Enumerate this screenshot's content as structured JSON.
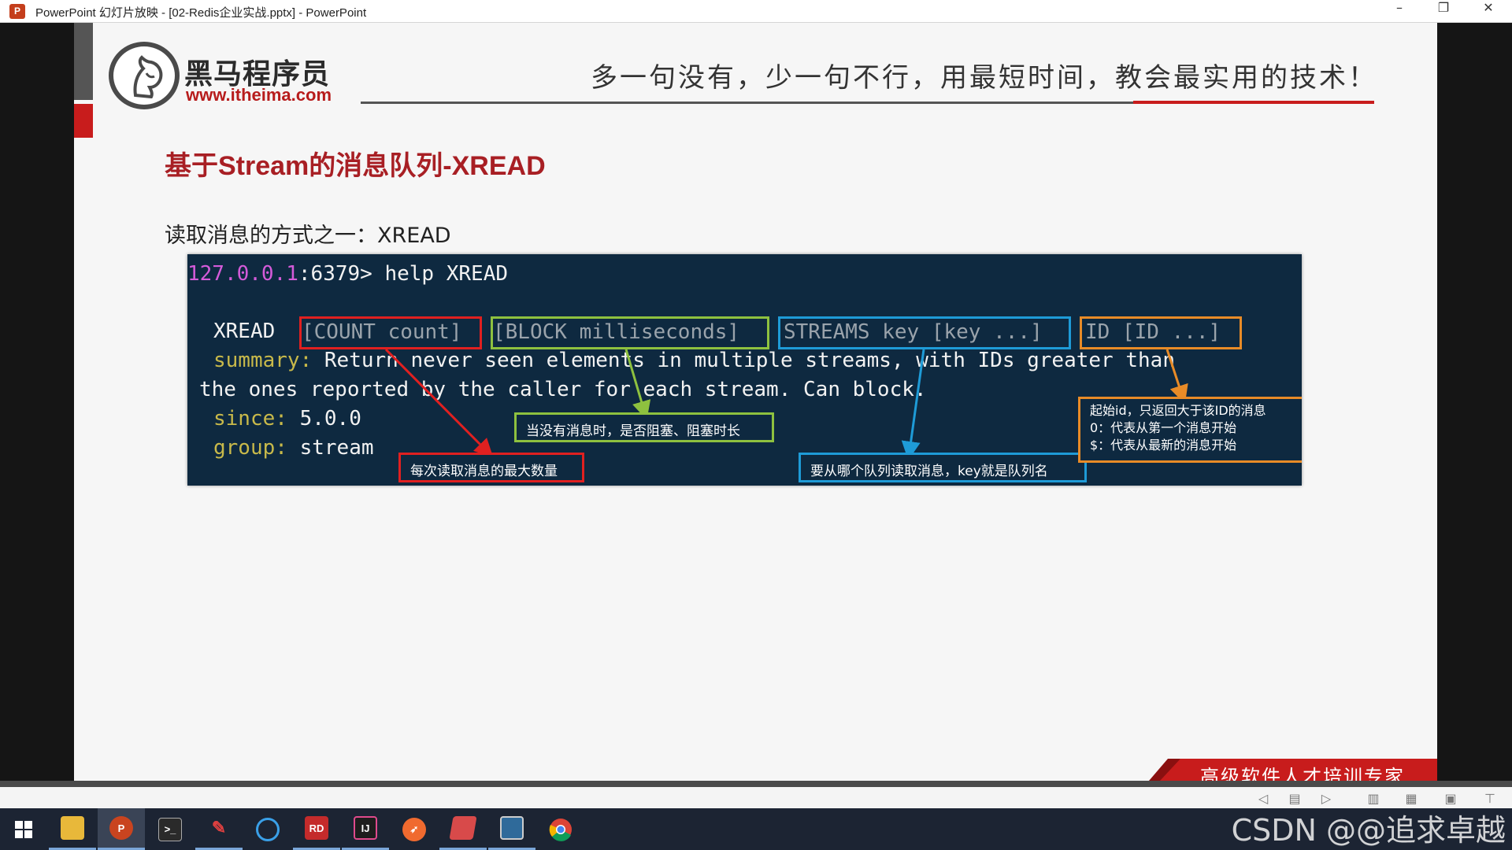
{
  "window": {
    "title": "PowerPoint 幻灯片放映 - [02-Redis企业实战.pptx] - PowerPoint",
    "app_icon": "P",
    "minimize": "–",
    "restore": "❐",
    "close": "✕"
  },
  "slide": {
    "logo_cn": "黑马程序员",
    "logo_url": "www.itheima.com",
    "slogan": "多一句没有，少一句不行，用最短时间，教会最实用的技术！",
    "title": "基于Stream的消息队列-XREAD",
    "subtitle": "读取消息的方式之一：XREAD",
    "terminal": {
      "prompt_ip": "127.0.0.1",
      "prompt_rest": ":6379> help XREAD",
      "cmd": "XREAD",
      "args": [
        "[COUNT count]",
        "[BLOCK milliseconds]",
        "STREAMS key [key ...]",
        "ID [ID ...]"
      ],
      "summary_label": "summary:",
      "summary_text_1": " Return never seen elements in multiple streams, with IDs greater than",
      "summary_text_2": "the ones reported by the caller for each stream. Can block.",
      "since_label": "since:",
      "since_value": " 5.0.0",
      "group_label": "group:",
      "group_value": " stream"
    },
    "notes": {
      "count": "每次读取消息的最大数量",
      "block": "当没有消息时，是否阻塞、阻塞时长",
      "key": "要从哪个队列读取消息，key就是队列名",
      "id_line1": "起始id，只返回大于该ID的消息",
      "id_line2": "0：代表从第一个消息开始",
      "id_line3": "$：代表从最新的消息开始"
    },
    "ribbon": "高级软件人才培训专家"
  },
  "colors": {
    "title_red": "#a81f24",
    "terminal_bg": "#0e2940",
    "count_box": "#e02020",
    "block_box": "#8ec13f",
    "streams_box": "#1e9bd7",
    "id_box": "#e88b27"
  },
  "taskbar": {
    "items": [
      "windows-start-icon",
      "file-explorer-icon",
      "powerpoint-icon",
      "terminal-icon",
      "pen-icon",
      "app-icon",
      "redis-desktop-icon",
      "intellij-icon",
      "postman-icon",
      "app-icon",
      "screenshot-tool-icon",
      "chrome-icon"
    ]
  },
  "watermark": "CSDN @@追求卓越"
}
